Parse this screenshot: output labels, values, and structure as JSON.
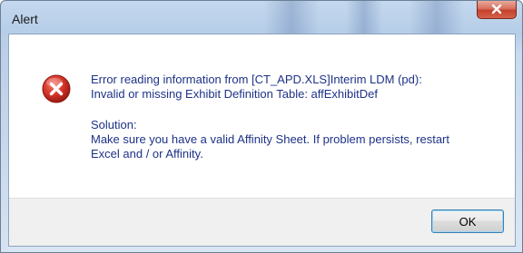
{
  "window": {
    "title": "Alert"
  },
  "dialog": {
    "icon": "error-icon",
    "message_lines": [
      "Error reading information from [CT_APD.XLS]Interim LDM (pd):",
      "Invalid or missing Exhibit Definition Table: affExhibitDef"
    ],
    "solution_heading": "Solution:",
    "solution_lines": [
      "Make sure you have a valid Affinity Sheet. If problem persists, restart",
      "Excel and / or Affinity."
    ]
  },
  "buttons": {
    "ok_label": "OK"
  },
  "colors": {
    "message_text": "#1e3287",
    "error_red": "#c8281e",
    "titlebar": "#b6cde8",
    "close_button": "#c4402b",
    "footer": "#f0f0f0"
  }
}
